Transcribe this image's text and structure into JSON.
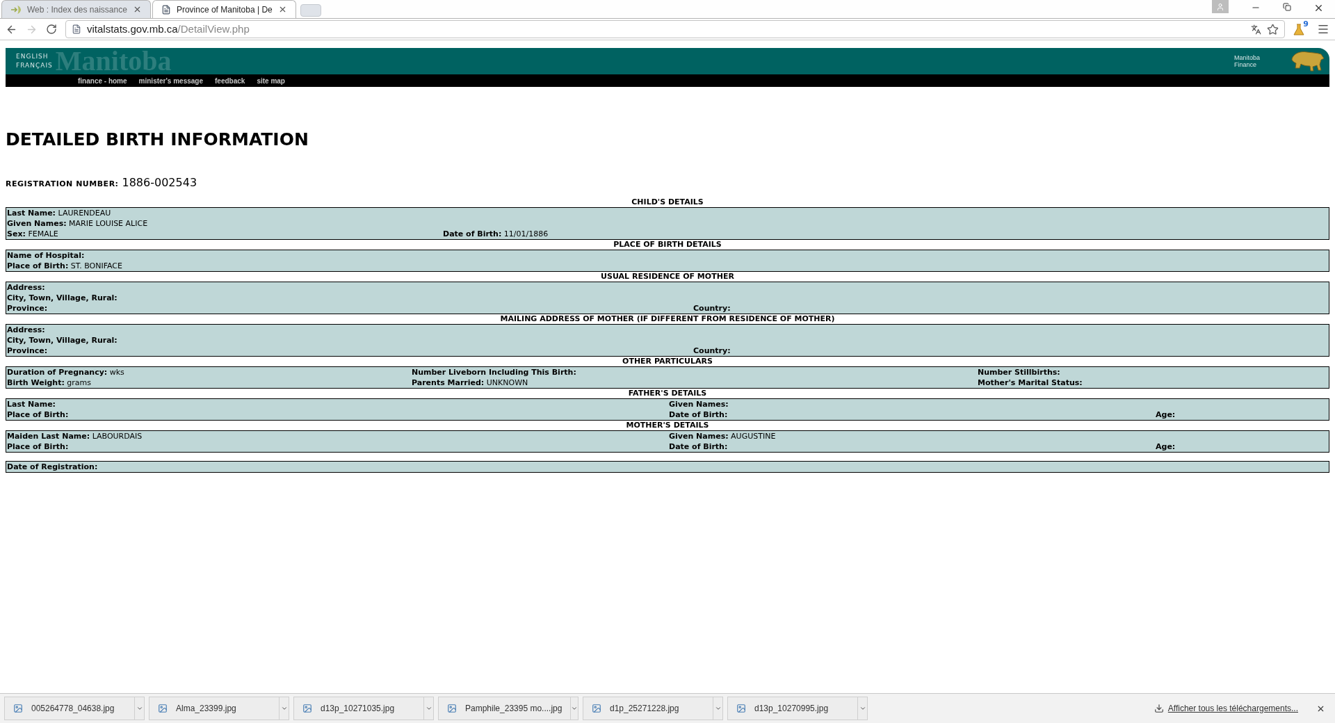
{
  "browser": {
    "tabs": [
      {
        "title": "Web : Index des naissance",
        "selected": false,
        "kind": "link"
      },
      {
        "title": "Province of Manitoba | De",
        "selected": true,
        "kind": "page"
      }
    ],
    "address": {
      "host": "vitalstats.gov.mb.ca",
      "path": "/DetailView.php"
    },
    "extension_badge": "9"
  },
  "header": {
    "languages": [
      "ENGLISH",
      "FRANÇAIS"
    ],
    "wordmark": "Manitoba",
    "nav": [
      "finance - home",
      "minister's message",
      "feedback",
      "site map"
    ],
    "department": [
      "Manitoba",
      "Finance"
    ]
  },
  "page": {
    "title": "DETAILED BIRTH INFORMATION",
    "registration": {
      "label": "REGISTRATION NUMBER:",
      "value": "1886-002543"
    },
    "sections": [
      {
        "heading": "CHILD'S DETAILS",
        "kind": "split",
        "rows": [
          [
            {
              "label": "Last Name:",
              "value": "LAURENDEAU"
            }
          ],
          [
            {
              "label": "Given Names:",
              "value": "MARIE LOUISE ALICE"
            }
          ],
          [
            {
              "label": "Sex:",
              "value": "FEMALE"
            },
            {
              "label": "Date of Birth:",
              "value": "11/01/1886"
            }
          ]
        ]
      },
      {
        "heading": "PLACE OF BIRTH DETAILS",
        "kind": "split",
        "rows": [
          [
            {
              "label": "Name of Hospital:"
            }
          ],
          [
            {
              "label": "Place of Birth:",
              "value": "ST. BONIFACE"
            }
          ]
        ]
      },
      {
        "heading": "USUAL RESIDENCE OF MOTHER",
        "kind": "country",
        "rows": [
          [
            {
              "label": "Address:"
            }
          ],
          [
            {
              "label": "City, Town, Village, Rural:"
            }
          ],
          [
            {
              "label": "Province:"
            },
            {
              "label": "Country:"
            }
          ]
        ]
      },
      {
        "heading": "MAILING ADDRESS OF MOTHER (IF DIFFERENT FROM RESIDENCE OF MOTHER)",
        "kind": "country",
        "rows": [
          [
            {
              "label": "Address:"
            }
          ],
          [
            {
              "label": "City, Town, Village, Rural:"
            }
          ],
          [
            {
              "label": "Province:"
            },
            {
              "label": "Country:"
            }
          ]
        ]
      },
      {
        "heading": "OTHER PARTICULARS",
        "kind": "particulars",
        "rows": [
          [
            {
              "label": "Duration of Pregnancy:",
              "value": "wks"
            },
            {
              "label": "Number Liveborn Including This Birth:"
            },
            {
              "label": "Number Stillbirths:"
            }
          ],
          [
            {
              "label": "Birth Weight:",
              "value": "grams"
            },
            {
              "label": "Parents Married:",
              "value": "UNKNOWN"
            },
            {
              "label": "Mother's Marital Status:"
            }
          ]
        ]
      },
      {
        "heading": "FATHER'S DETAILS",
        "kind": "parent",
        "rows": [
          [
            {
              "label": "Last Name:"
            },
            {
              "label": "Given Names:"
            }
          ],
          [
            {
              "label": "Place of Birth:"
            },
            {
              "label": "Date of Birth:"
            },
            {
              "label": "Age:"
            }
          ]
        ]
      },
      {
        "heading": "MOTHER'S DETAILS",
        "kind": "parent",
        "rows": [
          [
            {
              "label": "Maiden Last Name:",
              "value": "LABOURDAIS"
            },
            {
              "label": "Given Names:",
              "value": "AUGUSTINE"
            }
          ],
          [
            {
              "label": "Place of Birth:"
            },
            {
              "label": "Date of Birth:"
            },
            {
              "label": "Age:"
            }
          ]
        ]
      },
      {
        "kind": "single",
        "rows": [
          [
            {
              "label": "Date of Registration:"
            }
          ]
        ]
      }
    ]
  },
  "downloads": {
    "items": [
      "005264778_04638.jpg",
      "Alma_23399.jpg",
      "d13p_10271035.jpg",
      "Pamphile_23395 mo....jpg",
      "d1p_25271228.jpg",
      "d13p_10270995.jpg"
    ],
    "show_all": "Afficher tous les téléchargements..."
  }
}
